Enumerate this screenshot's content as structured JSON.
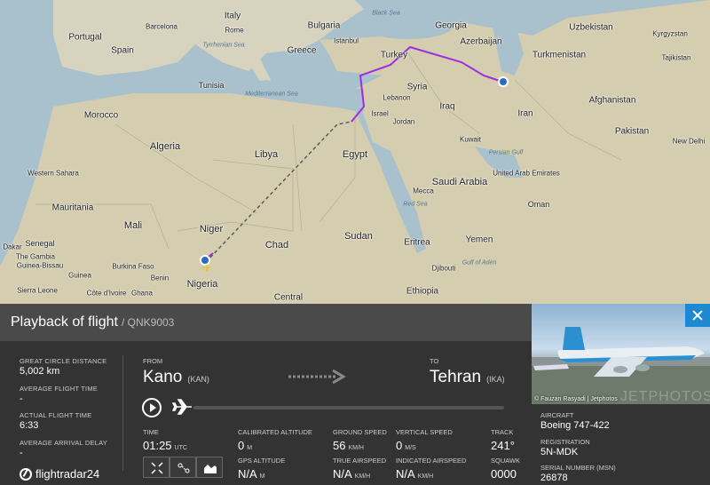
{
  "map": {
    "labels": {
      "italy": "Italy",
      "portugal": "Portugal",
      "spain": "Spain",
      "barcelona": "Barcelona",
      "rome": "Rome",
      "tyrrhenian": "Tyrrhenian Sea",
      "balkan": "Bulgaria",
      "greece": "Greece",
      "istanbul": "Istanbul",
      "black_sea": "Black Sea",
      "georgia": "Georgia",
      "azerbaijan": "Azerbaijan",
      "uzbekistan": "Uzbekistan",
      "kyrgyzstan": "Kyrgyzstan",
      "turkmenistan": "Turkmenistan",
      "tajikistan": "Tajikistan",
      "turkey": "Turkey",
      "tunisia": "Tunisia",
      "med": "Mediterranean Sea",
      "syria": "Syria",
      "lebanon": "Lebanon",
      "iraq": "Iraq",
      "iran": "Iran",
      "afghanistan": "Afghanistan",
      "morocco": "Morocco",
      "algeria": "Algeria",
      "libya": "Libya",
      "israel": "Israel",
      "jordan": "Jordan",
      "egypt": "Egypt",
      "kuwait": "Kuwait",
      "pakistan": "Pakistan",
      "new_delhi": "New Delhi",
      "persian_gulf": "Persian Gulf",
      "western_sahara": "Western Sahara",
      "saudi": "Saudi Arabia",
      "uae": "United Arab Emirates",
      "mauritania": "Mauritania",
      "mecca": "Mecca",
      "oman": "Oman",
      "red_sea": "Red Sea",
      "mali": "Mali",
      "niger": "Niger",
      "chad": "Chad",
      "sudan": "Sudan",
      "eritrea": "Eritrea",
      "yemen": "Yemen",
      "dakar": "Dakar",
      "senegal": "Senegal",
      "gambia": "The Gambia",
      "guinea_bissau": "Guinea-Bissau",
      "burkina": "Burkina Faso",
      "guinea": "Guinea",
      "benin": "Benin",
      "gulf_aden": "Gulf of Aden",
      "djibouti": "Djibouti",
      "sierra_leone": "Sierra Leone",
      "cote": "Côte d'Ivoire",
      "ghana": "Ghana",
      "nigeria": "Nigeria",
      "central": "Central",
      "ethiopia": "Ethiopia",
      "kano": "Kano",
      "tehran": "Tehran"
    }
  },
  "header": {
    "title": "Playback of flight",
    "separator": "/",
    "flight": "QNK9003"
  },
  "stats": {
    "distance_label": "GREAT CIRCLE DISTANCE",
    "distance": "5,002 km",
    "avg_time_label": "AVERAGE FLIGHT TIME",
    "avg_time": "-",
    "actual_time_label": "ACTUAL FLIGHT TIME",
    "actual_time": "6:33",
    "avg_delay_label": "AVERAGE ARRIVAL DELAY",
    "avg_delay": "-"
  },
  "logo": {
    "text": "flightradar24"
  },
  "route": {
    "from_label": "FROM",
    "from_city": "Kano",
    "from_code": "(KAN)",
    "to_label": "TO",
    "to_city": "Tehran",
    "to_code": "(IKA)"
  },
  "playback": {
    "progress": 0
  },
  "telemetry": {
    "time_label": "TIME",
    "time": "01:25",
    "time_unit": "UTC",
    "cal_alt_label": "CALIBRATED ALTITUDE",
    "cal_alt": "0",
    "cal_alt_unit": "M",
    "gps_alt_label": "GPS ALTITUDE",
    "gps_alt": "N/A",
    "gps_alt_unit": "M",
    "gs_label": "GROUND SPEED",
    "gs": "56",
    "gs_unit": "KM/H",
    "tas_label": "TRUE AIRSPEED",
    "tas": "N/A",
    "tas_unit": "KM/H",
    "vs_label": "VERTICAL SPEED",
    "vs": "0",
    "vs_unit": "M/S",
    "ias_label": "INDICATED AIRSPEED",
    "ias": "N/A",
    "ias_unit": "KM/H",
    "track_label": "TRACK",
    "track": "241°",
    "squawk_label": "SQUAWK",
    "squawk": "0000"
  },
  "aircraft": {
    "photo_credit": "© Fauzan Rasyadi | Jetphotos",
    "watermark": "JETPHOTOS.NET",
    "type_label": "AIRCRAFT",
    "type": "Boeing 747-422",
    "reg_label": "REGISTRATION",
    "reg": "5N-MDK",
    "msn_label": "SERIAL NUMBER (MSN)",
    "msn": "26878"
  },
  "colors": {
    "accent": "#1e88d0",
    "track_purple": "#9b30e0",
    "panel_bg": "#333333"
  }
}
